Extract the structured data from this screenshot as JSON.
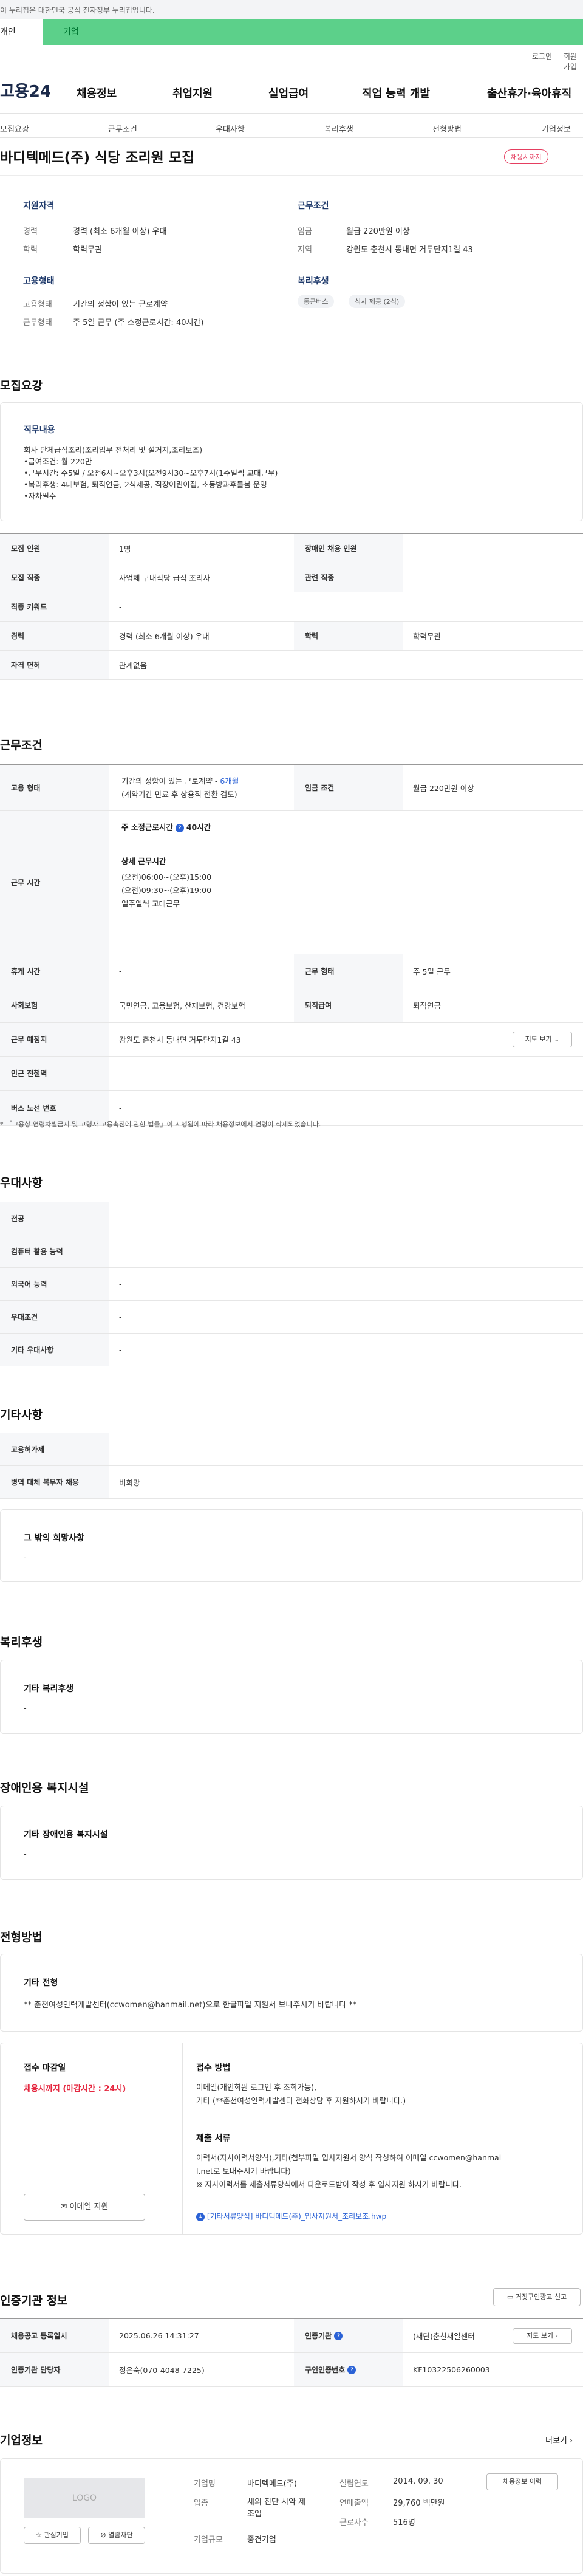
{
  "gov_banner": "이 누리집은 대한민국 공식 전자정부 누리집입니다.",
  "user_tabs": [
    "개인",
    "기업"
  ],
  "util_links": [
    "로그인",
    "회원가입"
  ],
  "logo": "고용24",
  "gnb": [
    "채용정보",
    "취업지원",
    "실업급여",
    "직업 능력 개발",
    "출산휴가·육아휴직"
  ],
  "subnav": [
    "모집요강",
    "근무조건",
    "우대사항",
    "복리후생",
    "전형방법",
    "기업정보"
  ],
  "job_title": "바디텍메드(주) 식당 조리원 모집",
  "status_badge": "채용시까지",
  "summary": {
    "qual_title": "지원자격",
    "career_label": "경력",
    "career_value": "경력 (최소 6개월 이상) 우대",
    "edu_label": "학력",
    "edu_value": "학력무관",
    "cond_title": "근무조건",
    "wage_label": "임금",
    "wage_value": "월급 220만원 이상",
    "loc_label": "지역",
    "loc_value": "강원도 춘천시 동내면 거두단지1길 43",
    "emp_title": "고용형태",
    "emptype_label": "고용형태",
    "emptype_value": "기간의 정함이 있는 근로계약",
    "worktype_label": "근무형태",
    "worktype_value": "주 5일 근무 (주 소정근로시간: 40시간)",
    "welfare_title": "복리후생",
    "welfare_tags": [
      "통근버스",
      "식사 제공 (2식)"
    ]
  },
  "recruit": {
    "heading": "모집요강",
    "duty_title": "직무내용",
    "duty_lines": [
      "회사 단체급식조리(조리업무 전처리 및 설거지,조리보조)",
      "•급여조건: 월 220만",
      "•근무시간: 주5일 / 오전6시~오후3시(오전9시30~오후7시(1주일씩 교대근무)",
      "•복리후생: 4대보험, 퇴직연금, 2식제공, 직장어린이집, 초등방과후돌봄 운영",
      "•자차필수"
    ],
    "rows": {
      "count_l": "모집 인원",
      "count_v": "1명",
      "disab_l": "장애인 채용 인원",
      "disab_v": "-",
      "job_l": "모집 직종",
      "job_v": "사업체 구내식당 급식 조리사",
      "rel_l": "관련 직종",
      "rel_v": "-",
      "kw_l": "직종 키워드",
      "kw_v": "-",
      "car_l": "경력",
      "car_v": "경력 (최소 6개월 이상) 우대",
      "edu_l": "학력",
      "edu_v": "학력무관",
      "lic_l": "자격 면허",
      "lic_v": "관계없음"
    }
  },
  "work": {
    "heading": "근무조건",
    "type_l": "고용 형태",
    "type_v1": "기간의 정함이 있는 근로계약 - ",
    "type_period": "6개월",
    "type_v2": "(계약기간 만료 후 상용직 전환 검토)",
    "wage_l": "임금 조건",
    "wage_v": "월급 220만원 이상",
    "hours_l": "근무 시간",
    "hours_main": "주 소정근로시간",
    "hours_q": "?",
    "hours_val": "40시간",
    "detail_title": "상세 근무시간",
    "detail_lines": [
      "(오전)06:00~(오후)15:00",
      "(오전)09:30~(오후)19:00",
      "일주일씩 교대근무"
    ],
    "break_l": "휴게 시간",
    "break_v": "-",
    "form_l": "근무 형태",
    "form_v": "주 5일 근무",
    "ins_l": "사회보험",
    "ins_v": "국민연금, 고용보험, 산재보험, 건강보험",
    "ret_l": "퇴직급여",
    "ret_v": "퇴직연금",
    "place_l": "근무 예정지",
    "place_v": "강원도 춘천시 동내면 거두단지1길 43",
    "map_btn": "지도 보기",
    "sub_l": "인근 전철역",
    "sub_v": "-",
    "bus_l": "버스 노선 번호",
    "bus_v": "-",
    "footnote": "* 「고용상 연령차별금지 및 고령자 고용촉진에 관한 법률」이 시행됨에 따라 채용정보에서 연령이 삭제되었습니다."
  },
  "pref": {
    "heading": "우대사항",
    "rows": [
      {
        "l": "전공",
        "v": "-"
      },
      {
        "l": "컴퓨터 활용 능력",
        "v": "-"
      },
      {
        "l": "외국어 능력",
        "v": "-"
      },
      {
        "l": "우대조건",
        "v": "-"
      },
      {
        "l": "기타 우대사항",
        "v": "-"
      }
    ]
  },
  "etc": {
    "heading": "기타사항",
    "rows": [
      {
        "l": "고용허가제",
        "v": "-"
      },
      {
        "l": "병역 대체 복무자 채용",
        "v": "비희망"
      }
    ],
    "box_title": "그 밖의 희망사항",
    "box_val": "-"
  },
  "welfare": {
    "heading": "복리후생",
    "box_title": "기타 복리후생",
    "box_val": "-"
  },
  "disab": {
    "heading": "장애인용 복지시설",
    "box_title": "기타 장애인용 복지시설",
    "box_val": "-"
  },
  "select": {
    "heading": "전형방법",
    "box_title": "기타 전형",
    "box_val": "** 춘천여성인력개발센터(ccwomen@hanmail.net)으로 한글파일 지원서 보내주시기 바랍니다 **",
    "deadline_title": "접수 마감일",
    "deadline_val": "채용시까지 (마감시간 : 24시)",
    "email_btn": "이메일 지원",
    "method_title": "접수 방법",
    "method_lines": [
      "이메일(개인회원 로그인 후 조회가능),",
      "기타 (**춘천여성인력개발센터 전화상담 후 지원하시기 바랍니다.)"
    ],
    "docs_title": "제출 서류",
    "docs_lines": [
      "이력서(자사이력서양식),기타(첨부파일 입사지원서 양식 작성하여 이메일 ccwomen@hanmai",
      "l.net로 보내주시기 바랍니다)",
      "※ 자사이력서를 제출서류양식에서 다운로드받아 작성 후 입사지원 하시기 바랍니다."
    ],
    "file_link": "[기타서류양식] 바디텍메드(주)_입사지원서_조리보조.hwp"
  },
  "cert": {
    "heading": "인증기관 정보",
    "report_btn": "거짓구인광고 신고",
    "reg_l": "채용공고 등록일시",
    "reg_v": "2025.06.26 14:31:27",
    "org_l": "인증기관",
    "org_q": "?",
    "org_v": "(재단)춘천새일센터",
    "map_btn": "지도 보기",
    "mgr_l": "인증기관 담당자",
    "mgr_v": "정은숙(070-4048-7225)",
    "no_l": "구인인증번호",
    "no_q": "?",
    "no_v": "KF10322506260003"
  },
  "company": {
    "heading": "기업정보",
    "more": "더보기",
    "logo": "LOGO",
    "fav_btn": "관심기업",
    "block_btn": "열람차단",
    "name_l": "기업명",
    "name_v": "바디텍메드(주)",
    "ind_l": "업종",
    "ind_v1": "체외 진단 시약 제",
    "ind_v2": "조업",
    "year_l": "설립연도",
    "year_v": "2014. 09. 30",
    "sales_l": "연매출액",
    "sales_v": "29,760 백만원",
    "emp_l": "근로자수",
    "emp_v": "516명",
    "size_l": "기업규모",
    "size_v": "중견기업",
    "history_btn": "채용정보 이력"
  }
}
